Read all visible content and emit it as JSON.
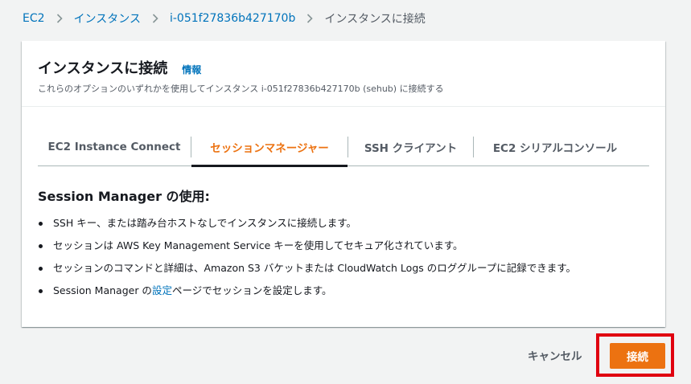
{
  "breadcrumb": {
    "items": [
      "EC2",
      "インスタンス",
      "i-051f27836b427170b"
    ],
    "current": "インスタンスに接続"
  },
  "panel": {
    "title": "インスタンスに接続",
    "info_link": "情報",
    "description": "これらのオプションのいずれかを使用してインスタンス i-051f27836b427170b (sehub) に接続する"
  },
  "tabs": [
    {
      "label": "EC2 Instance Connect",
      "active": false
    },
    {
      "label": "セッションマネージャー",
      "active": true
    },
    {
      "label": "SSH クライアント",
      "active": false
    },
    {
      "label": "EC2 シリアルコンソール",
      "active": false
    }
  ],
  "session_manager": {
    "heading": "Session Manager の使用:",
    "bullets": [
      "SSH キー、または踏み台ホストなしでインスタンスに接続します。",
      "セッションは AWS Key Management Service キーを使用してセキュア化されています。",
      "セッションのコマンドと詳細は、Amazon S3 バケットまたは CloudWatch Logs のロググループに記録できます。"
    ],
    "last_bullet_before": "Session Manager の",
    "last_bullet_link": "設定",
    "last_bullet_after": "ページでセッションを設定します。"
  },
  "footer": {
    "cancel_label": "キャンセル",
    "connect_label": "接続"
  },
  "colors": {
    "accent": "#ec7211",
    "link": "#0073bb",
    "highlight": "#e0000f",
    "background": "#f2f3f3"
  },
  "icons": {
    "breadcrumb_separator": "chevron-right-icon"
  }
}
